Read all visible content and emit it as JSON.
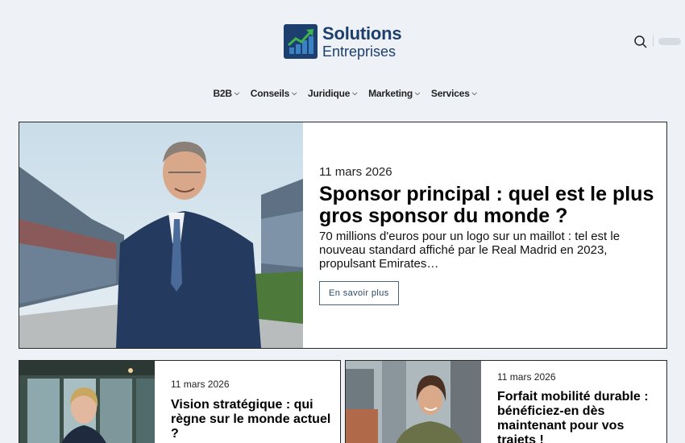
{
  "header": {
    "logo_line1": "Solutions",
    "logo_line2": "Entreprises",
    "search_icon": "search-icon"
  },
  "nav": {
    "items": [
      {
        "label": "B2B"
      },
      {
        "label": "Conseils"
      },
      {
        "label": "Juridique"
      },
      {
        "label": "Marketing"
      },
      {
        "label": "Services"
      }
    ]
  },
  "hero": {
    "date": "11 mars 2026",
    "title": "Sponsor principal : quel est le plus gros sponsor du monde ?",
    "excerpt": "70 millions d'euros pour un logo sur un maillot : tel est le nouveau standard affiché par le Real Madrid en 2023, propulsant Emirates…",
    "button_label": "En savoir plus"
  },
  "cards": [
    {
      "date": "11 mars 2026",
      "title": "Vision stratégique : qui règne sur le monde actuel ?"
    },
    {
      "date": "11 mars 2026",
      "title": "Forfait mobilité durable : bénéficiez-en dès maintenant pour vos trajets !"
    }
  ],
  "colors": {
    "brand": "#1d3f6e",
    "accent_green": "#3fb34f",
    "background": "#eef1f5"
  }
}
